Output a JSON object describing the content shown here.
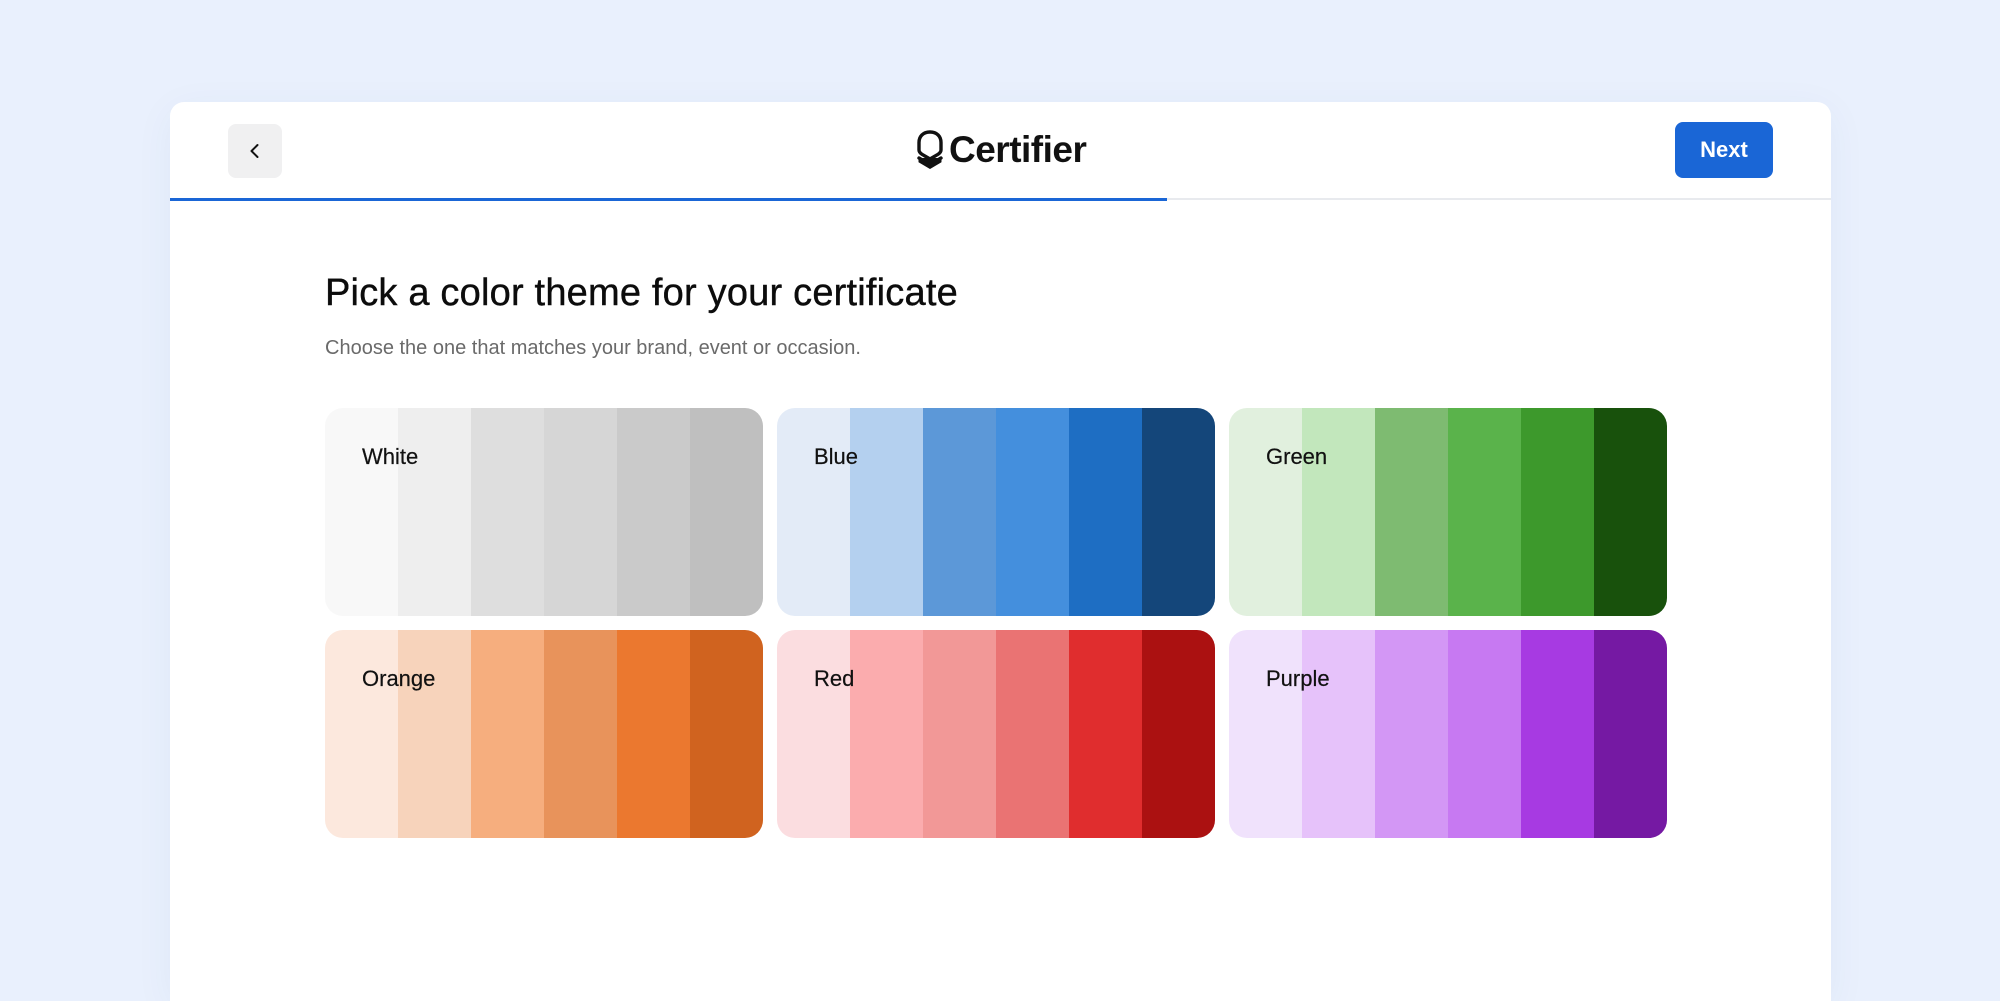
{
  "header": {
    "back_icon": "chevron-left-icon",
    "logo_icon": "certifier-shield-icon",
    "logo_text": "Certifier",
    "next_label": "Next",
    "progress": 0.6,
    "accent_color": "#1a66d6"
  },
  "main": {
    "title": "Pick a color theme for your certificate",
    "subtitle": "Choose the one that matches your brand, event or occasion."
  },
  "themes": [
    {
      "name": "White",
      "colors": [
        "#f8f8f8",
        "#eeeeee",
        "#dedede",
        "#d6d6d6",
        "#cacaca",
        "#bfbfbf"
      ]
    },
    {
      "name": "Blue",
      "colors": [
        "#e3ebf7",
        "#b4d0ef",
        "#5c98d8",
        "#448fdd",
        "#1e6ec3",
        "#14467a"
      ]
    },
    {
      "name": "Green",
      "colors": [
        "#e1f0de",
        "#c2e7bc",
        "#7ebb71",
        "#5ab34b",
        "#3d992c",
        "#18510c"
      ]
    },
    {
      "name": "Orange",
      "colors": [
        "#fce8dd",
        "#f7d3bb",
        "#f6ae7e",
        "#e8935b",
        "#eb782f",
        "#d0631f"
      ]
    },
    {
      "name": "Red",
      "colors": [
        "#fbdde0",
        "#fbacae",
        "#f29897",
        "#ea7373",
        "#e02d2e",
        "#ab1111"
      ]
    },
    {
      "name": "Purple",
      "colors": [
        "#f0e2fc",
        "#e6c2fa",
        "#d397f5",
        "#c779f2",
        "#a73ae2",
        "#7519a3"
      ]
    }
  ]
}
